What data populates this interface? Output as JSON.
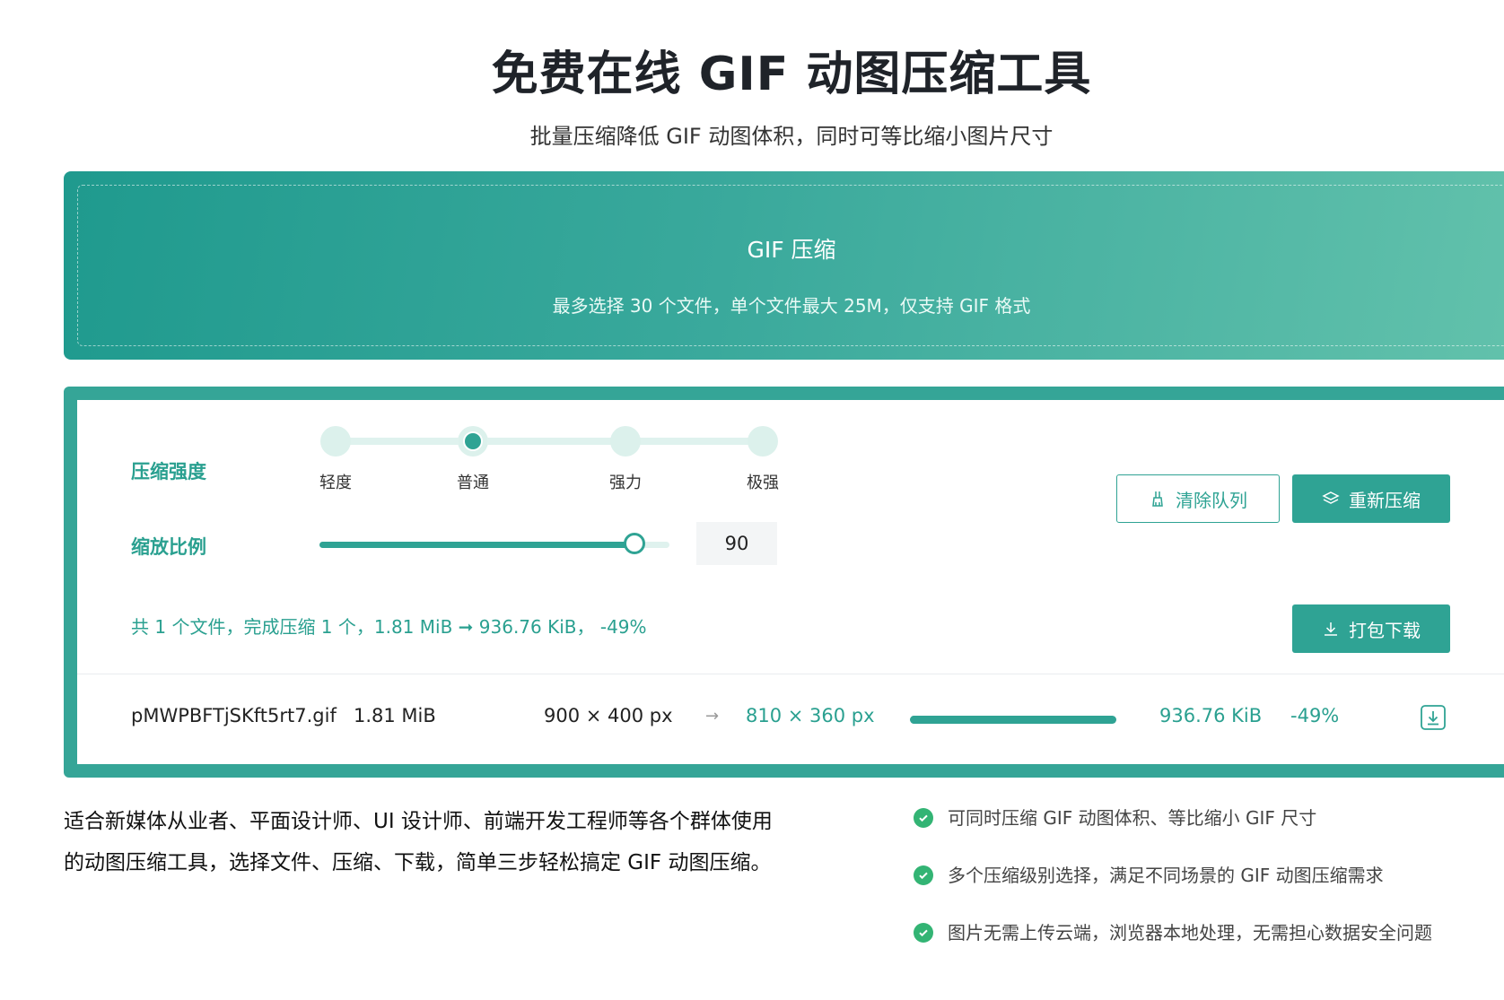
{
  "header": {
    "title": "免费在线 GIF 动图压缩工具",
    "subtitle": "批量压缩降低 GIF 动图体积，同时可等比缩小图片尺寸"
  },
  "upload": {
    "title": "GIF 压缩",
    "hint": "最多选择 30 个文件，单个文件最大 25M，仅支持 GIF 格式"
  },
  "settings": {
    "strength_label": "压缩强度",
    "levels": [
      "轻度",
      "普通",
      "强力",
      "极强"
    ],
    "selected_level": "普通",
    "scale_label": "缩放比例",
    "scale_value": "90",
    "scale_percent": 90
  },
  "actions": {
    "clear_label": "清除队列",
    "recompress_label": "重新压缩",
    "download_all_label": "打包下载"
  },
  "summary": "共 1 个文件，完成压缩 1 个，1.81 MiB ➞ 936.76 KiB， -49%",
  "files": [
    {
      "name": "pMWPBFTjSKft5rt7.gif",
      "size": "1.81 MiB",
      "orig_dim": "900 × 400 px",
      "arrow": "→",
      "new_dim": "810 × 360 px",
      "progress": 100,
      "new_size": "936.76 KiB",
      "ratio": "-49%"
    }
  ],
  "description": "适合新媒体从业者、平面设计师、UI 设计师、前端开发工程师等各个群体使用的动图压缩工具，选择文件、压缩、下载，简单三步轻松搞定 GIF 动图压缩。",
  "features": [
    "可同时压缩 GIF 动图体积、等比缩小 GIF 尺寸",
    "多个压缩级别选择，满足不同场景的 GIF 动图压缩需求",
    "图片无需上传云端，浏览器本地处理，无需担心数据安全问题"
  ],
  "colors": {
    "accent": "#2fa394",
    "check": "#33b474"
  }
}
